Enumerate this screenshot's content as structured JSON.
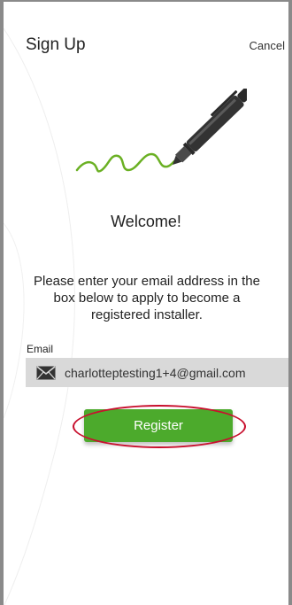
{
  "header": {
    "title": "Sign Up",
    "cancel_label": "Cancel"
  },
  "main": {
    "welcome": "Welcome!",
    "instructions": "Please enter your email address in the box below to apply to become a registered installer.",
    "email_label": "Email",
    "email_value": "charlotteptesting1+4@gmail.com",
    "register_label": "Register"
  },
  "icons": {
    "illustration": "pen-signature-icon",
    "email": "mail-icon"
  },
  "colors": {
    "accent_green": "#4caa2c",
    "signature_green": "#6ab023",
    "highlight_red": "#c8102e",
    "field_background": "#d9d9d9"
  }
}
